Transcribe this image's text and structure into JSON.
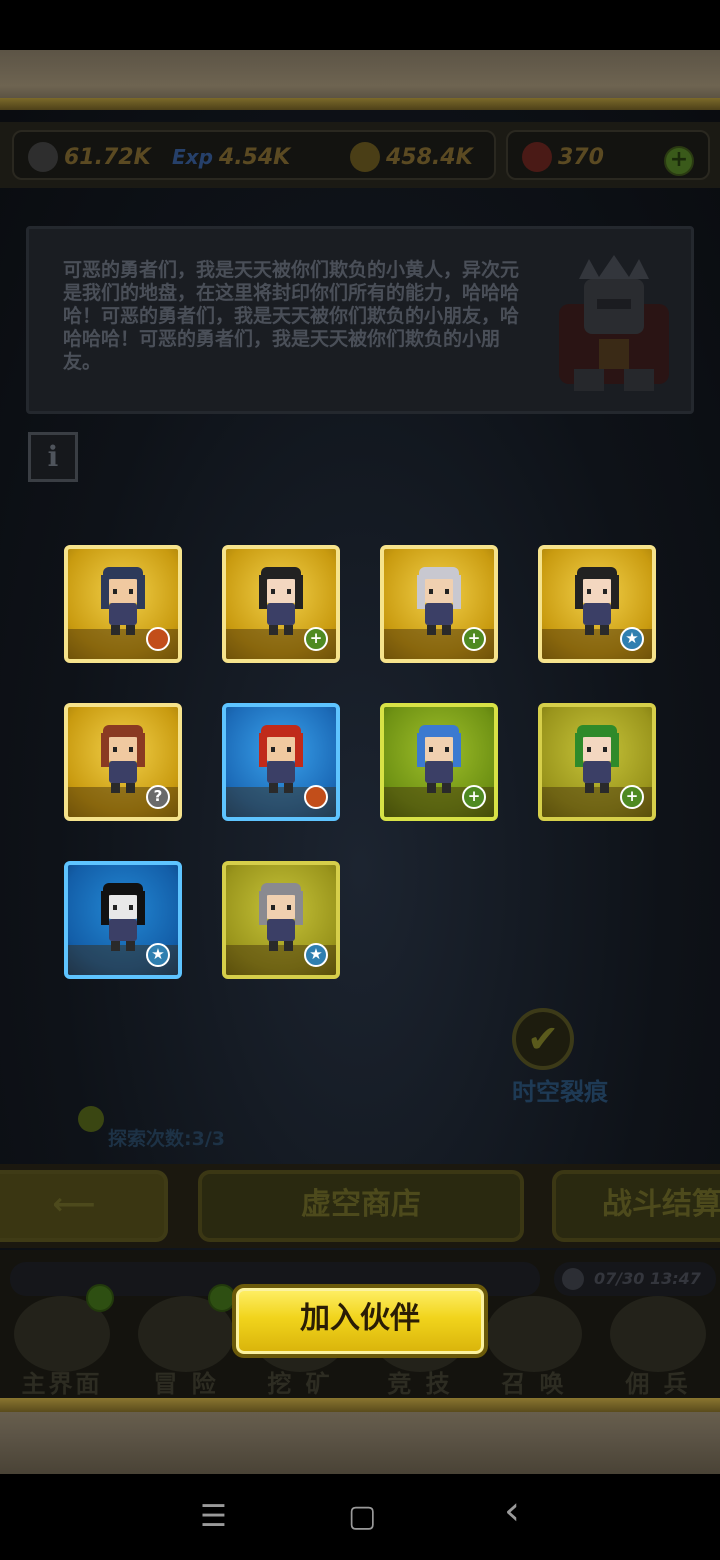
{
  "resources": {
    "attack": "61.72K",
    "exp_icon_text": "Exp",
    "exp": "4.54K",
    "gold": "458.4K",
    "gems": "370",
    "add_symbol": "+"
  },
  "dialog": {
    "text": "可恶的勇者们，我是天天被你们欺负的小黄人，异次元是我们的地盘，在这里将封印你们所有的能力，哈哈哈哈！可恶的勇者们，我是天天被你们欺负的小朋友，哈哈哈哈！可恶的勇者们，我是天天被你们欺负的小朋友。"
  },
  "info_button": {
    "label": "i"
  },
  "heroes": [
    {
      "rarity": "gold",
      "badge": "fire"
    },
    {
      "rarity": "gold",
      "badge": "plus"
    },
    {
      "rarity": "gold",
      "badge": "plus"
    },
    {
      "rarity": "gold",
      "badge": "star"
    },
    {
      "rarity": "gold",
      "badge": "question"
    },
    {
      "rarity": "blue",
      "badge": "fire"
    },
    {
      "rarity": "green",
      "badge": "plus"
    },
    {
      "rarity": "olive",
      "badge": "plus"
    },
    {
      "rarity": "teal",
      "badge": "star"
    },
    {
      "rarity": "olive",
      "badge": "star"
    }
  ],
  "badge_glyphs": {
    "plus": "+",
    "star": "★",
    "question": "?"
  },
  "rift": {
    "label": "时空裂痕",
    "check": "✔"
  },
  "explore": {
    "label": "探索次数:3/3"
  },
  "nav": {
    "back_arrow": "⟵",
    "shop": "虚空商店",
    "battle": "战斗结算"
  },
  "timer": "07/30 13:47",
  "tabs": [
    "主界面",
    "冒 险",
    "挖 矿",
    "竞 技",
    "召 唤",
    "佣 兵"
  ],
  "join_button": "加入伙伴",
  "android": {
    "menu": "☰",
    "home": "▢",
    "back": "‹"
  }
}
